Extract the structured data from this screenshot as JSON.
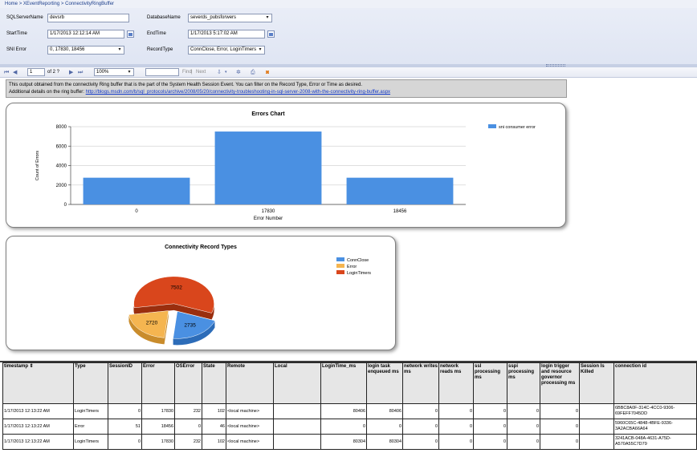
{
  "breadcrumb": {
    "items": [
      "Home",
      "XEventReporting",
      "ConnectivityRingBuffer"
    ],
    "separator": ">"
  },
  "params": {
    "sql_server_label": "SQLServerName",
    "sql_server_value": "devsrb",
    "database_label": "DatabaseName",
    "database_value": "severds_pubsforwers",
    "start_label": "StartTime",
    "start_value": "1/17/2013 12:12:14 AM",
    "end_label": "EndTime",
    "end_value": "1/17/2013 5:17:02 AM",
    "sni_label": "SNI Error",
    "sni_value": "0, 17830, 18456",
    "record_type_label": "RecordType",
    "record_type_value": "ConnClose, Error, LoginTimers"
  },
  "toolbar": {
    "page_value": "1",
    "page_of": "of 2 ?",
    "zoom_value": "100%",
    "find_label": "Find",
    "next_label": "Next"
  },
  "note": {
    "line1": "This output obtained from the connectivity Ring buffer that is the part of the System Health Session Event. You can filter on the Record Type, Error or Time as desired.",
    "line2_prefix": "Additional details on the ring buffer: ",
    "link": "http://blogs.msdn.com/b/sql_protocols/archive/2008/05/20/connectivity-troubleshooting-in-sql-server-2008-with-the-connectivity-ring-buffer.aspx"
  },
  "chart_data": [
    {
      "type": "bar",
      "title": "Errors Chart",
      "xlabel": "Error Number",
      "ylabel": "Count of Errors",
      "categories": [
        "0",
        "17830",
        "18456"
      ],
      "series": [
        {
          "name": "sni consumer error",
          "values": [
            2750,
            7500,
            2750
          ]
        }
      ],
      "ylim": [
        0,
        8000
      ],
      "yticks": [
        0,
        2000,
        4000,
        6000,
        8000
      ],
      "grid": true,
      "legend": "top-right",
      "color": "#4a90e2"
    },
    {
      "type": "pie",
      "title": "Connectivity Record Types",
      "categories": [
        "ConnClose",
        "Error",
        "LoginTimers"
      ],
      "values": [
        2735,
        2720,
        7502
      ],
      "colors": [
        "#4a90e2",
        "#f5b550",
        "#d9461c"
      ],
      "legend": "top-right",
      "data_labels": [
        "2735",
        "2720",
        "7502"
      ]
    }
  ],
  "table": {
    "columns": [
      "timestamp",
      "Type",
      "SessionID",
      "Error",
      "OSError",
      "State",
      "Remote",
      "Local",
      "LoginTime_ms",
      "login task enqueued ms",
      "network writes ms",
      "network reads ms",
      "ssl processing ms",
      "sspi processing ms",
      "login trigger and resource governor processing ms",
      "Session Is Killed",
      "connection id"
    ],
    "rows": [
      [
        "1/17/2013 12:13:22 AM",
        "LoginTimers",
        "0",
        "17830",
        "232",
        "102",
        "<local machine>",
        "",
        "80406",
        "80406",
        "0",
        "0",
        "0",
        "0",
        "0",
        "",
        "6BBC8A0F-314C-4CC0-9306-69FEFF7045DD"
      ],
      [
        "1/17/2013 12:13:22 AM",
        "Error",
        "51",
        "18456",
        "0",
        "46",
        "<local machine>",
        "",
        "0",
        "0",
        "0",
        "0",
        "0",
        "0",
        "0",
        "",
        "5960C65C-4848-4BFE-9336-3A2ACBA66A64"
      ],
      [
        "1/17/2013 12:13:22 AM",
        "LoginTimers",
        "0",
        "17830",
        "232",
        "102",
        "<local machine>",
        "",
        "80304",
        "80304",
        "0",
        "0",
        "0",
        "0",
        "0",
        "",
        "3241ACB-048A-4631-A75D-A570A55C7D79"
      ]
    ]
  }
}
